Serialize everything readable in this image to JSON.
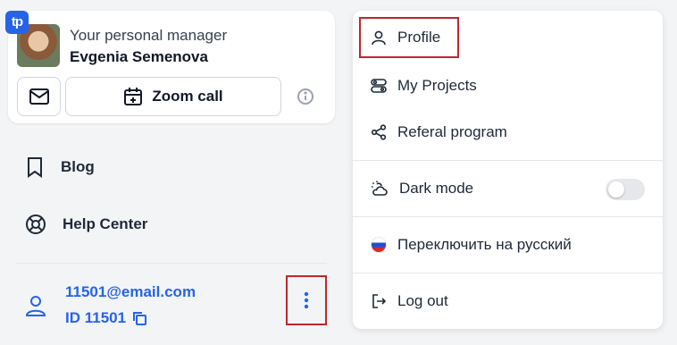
{
  "manager": {
    "caption": "Your personal manager",
    "name": "Evgenia Semenova",
    "zoom_label": "Zoom call"
  },
  "nav": {
    "blog": "Blog",
    "help_center": "Help Center"
  },
  "user": {
    "email": "11501@email.com",
    "id": "ID 11501"
  },
  "menu": {
    "profile": "Profile",
    "my_projects": "My Projects",
    "referal": "Referal program",
    "dark_mode": "Dark mode",
    "dark_mode_enabled": false,
    "language": "Переключить на русский",
    "logout": "Log out"
  },
  "colors": {
    "accent": "#2563eb",
    "highlight": "#c0262d"
  },
  "icons": {
    "logo": "tp",
    "mail": "mail-icon",
    "calendar": "calendar-plus-icon",
    "info": "info-icon",
    "bookmark": "bookmark-icon",
    "lifebuoy": "lifebuoy-icon",
    "user": "user-icon",
    "copy": "copy-icon",
    "more": "more-vertical-icon",
    "projects": "toggles-icon",
    "share": "share-icon",
    "weather": "cloud-sun-icon",
    "flag": "russia-flag-icon",
    "logout": "logout-icon"
  }
}
